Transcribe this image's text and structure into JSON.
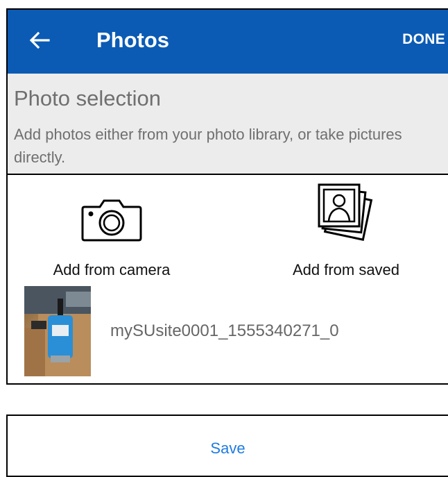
{
  "appbar": {
    "title": "Photos",
    "done_label": "DONE",
    "color": "#0b5bb5"
  },
  "section": {
    "title": "Photo selection",
    "description": "Add photos either from your photo library, or take pictures directly."
  },
  "actions": {
    "camera_label": "Add from camera",
    "saved_label": "Add from saved",
    "camera_icon": "camera-icon",
    "saved_icon": "photo-stack-icon"
  },
  "photos": [
    {
      "name": "mySUsite0001_1555340271_0"
    }
  ],
  "save": {
    "label": "Save",
    "color": "#1e7be0"
  }
}
